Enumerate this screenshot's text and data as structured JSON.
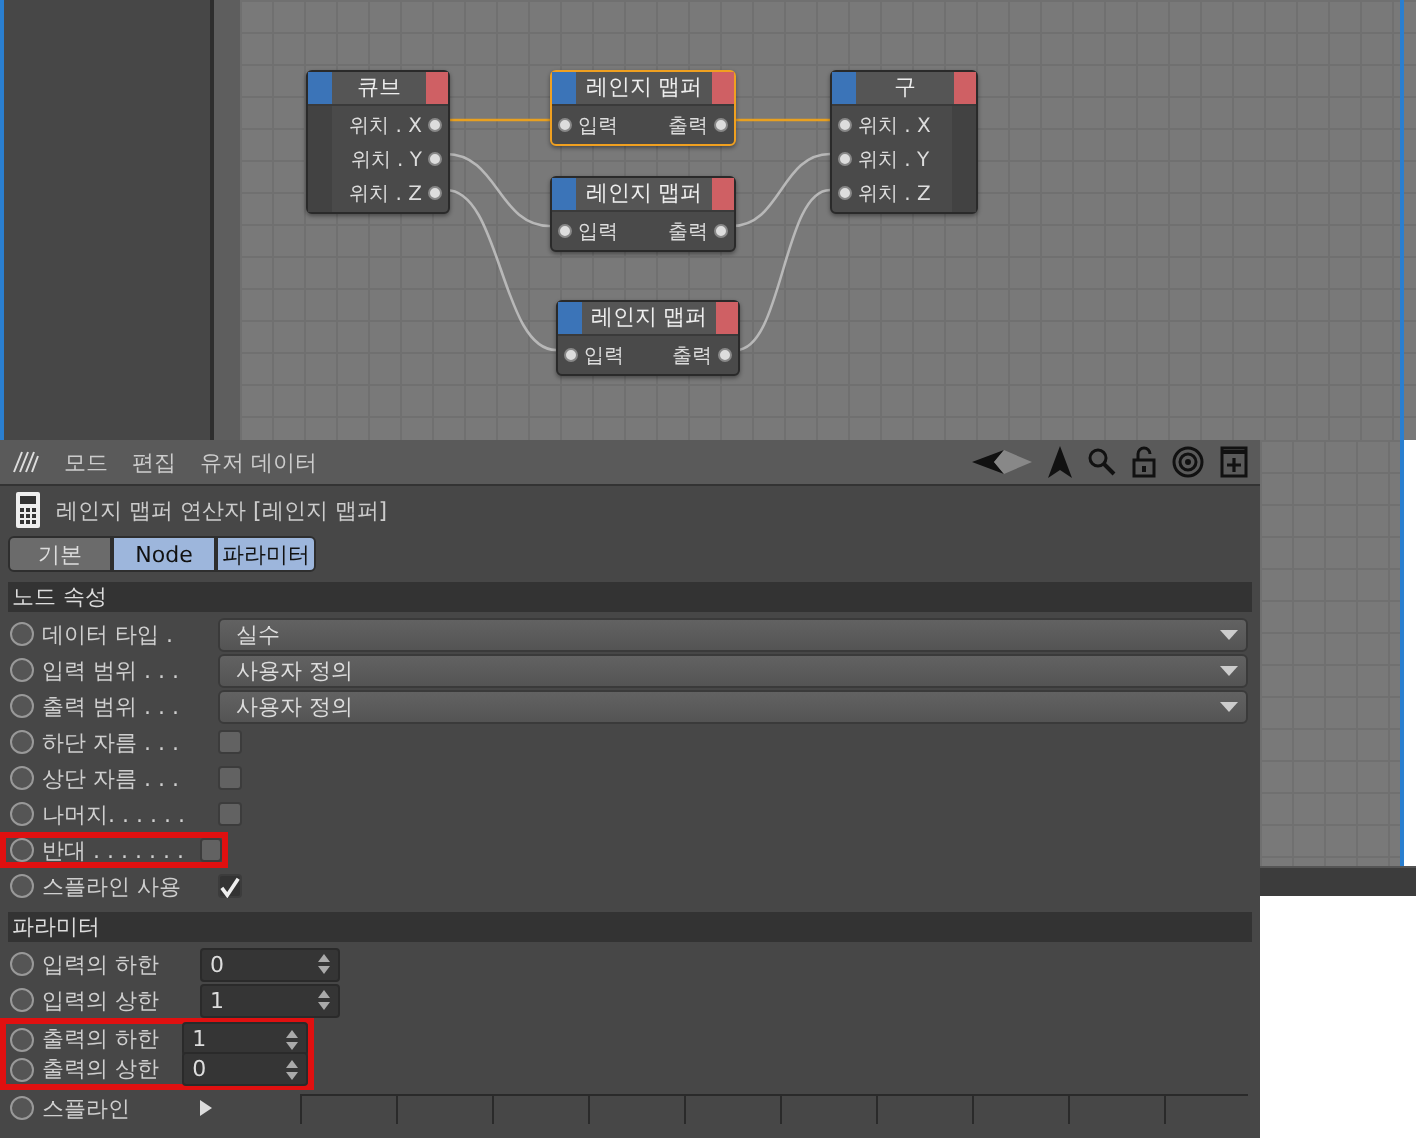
{
  "node_editor": {
    "nodes": [
      {
        "title": "큐브",
        "selected": false,
        "ports": [
          {
            "label": "위치 . X",
            "kind": "output"
          },
          {
            "label": "위치 . Y",
            "kind": "output"
          },
          {
            "label": "위치 . Z",
            "kind": "output"
          }
        ]
      },
      {
        "title": "레인지 맵퍼",
        "selected": true,
        "ports": [
          {
            "label": "입력",
            "kind": "input"
          },
          {
            "label": "출력",
            "kind": "output"
          }
        ]
      },
      {
        "title": "레인지 맵퍼",
        "selected": false,
        "ports": [
          {
            "label": "입력",
            "kind": "input"
          },
          {
            "label": "출력",
            "kind": "output"
          }
        ]
      },
      {
        "title": "레인지 맵퍼",
        "selected": false,
        "ports": [
          {
            "label": "입력",
            "kind": "input"
          },
          {
            "label": "출력",
            "kind": "output"
          }
        ]
      },
      {
        "title": "구",
        "selected": false,
        "ports": [
          {
            "label": "위치 . X",
            "kind": "input"
          },
          {
            "label": "위치 . Y",
            "kind": "input"
          },
          {
            "label": "위치 . Z",
            "kind": "input"
          }
        ]
      }
    ]
  },
  "attributes": {
    "menu": [
      "모드",
      "편집",
      "유저 데이터"
    ],
    "title": "레인지 맵퍼 연산자 [레인지 맵퍼]",
    "tabs": [
      {
        "label": "기본",
        "selected": false
      },
      {
        "label": "Node",
        "selected": true
      },
      {
        "label": "파라미터",
        "selected": true
      }
    ],
    "sections": [
      {
        "title": "노드 속성",
        "rows": [
          {
            "kind": "dropdown",
            "label": "데이터 타입 .",
            "value": "실수",
            "highlighted": false
          },
          {
            "kind": "dropdown",
            "label": "입력 범위 . . .",
            "value": "사용자 정의",
            "highlighted": false
          },
          {
            "kind": "dropdown",
            "label": "출력 범위 . . .",
            "value": "사용자 정의",
            "highlighted": false
          },
          {
            "kind": "checkbox",
            "label": "하단 자름 . . .",
            "checked": false,
            "highlighted": false
          },
          {
            "kind": "checkbox",
            "label": "상단 자름 . . .",
            "checked": false,
            "highlighted": false
          },
          {
            "kind": "checkbox",
            "label": "나머지. . . . . .",
            "checked": false,
            "highlighted": false
          },
          {
            "kind": "checkbox",
            "label": "반대 . . . . . . .",
            "checked": false,
            "highlighted": true
          },
          {
            "kind": "checkbox",
            "label": "스플라인 사용",
            "checked": true,
            "highlighted": false
          }
        ]
      },
      {
        "title": "파라미터",
        "rows": [
          {
            "kind": "number",
            "label": "입력의 하한",
            "value": "0",
            "highlighted": false
          },
          {
            "kind": "number",
            "label": "입력의 상한",
            "value": "1",
            "highlighted": false
          },
          {
            "kind": "number",
            "label": "출력의 하한",
            "value": "1",
            "highlighted": true
          },
          {
            "kind": "number",
            "label": "출력의 상한",
            "value": "0",
            "highlighted": true
          },
          {
            "kind": "spline",
            "label": "스플라인",
            "highlighted": false
          }
        ]
      }
    ]
  }
}
